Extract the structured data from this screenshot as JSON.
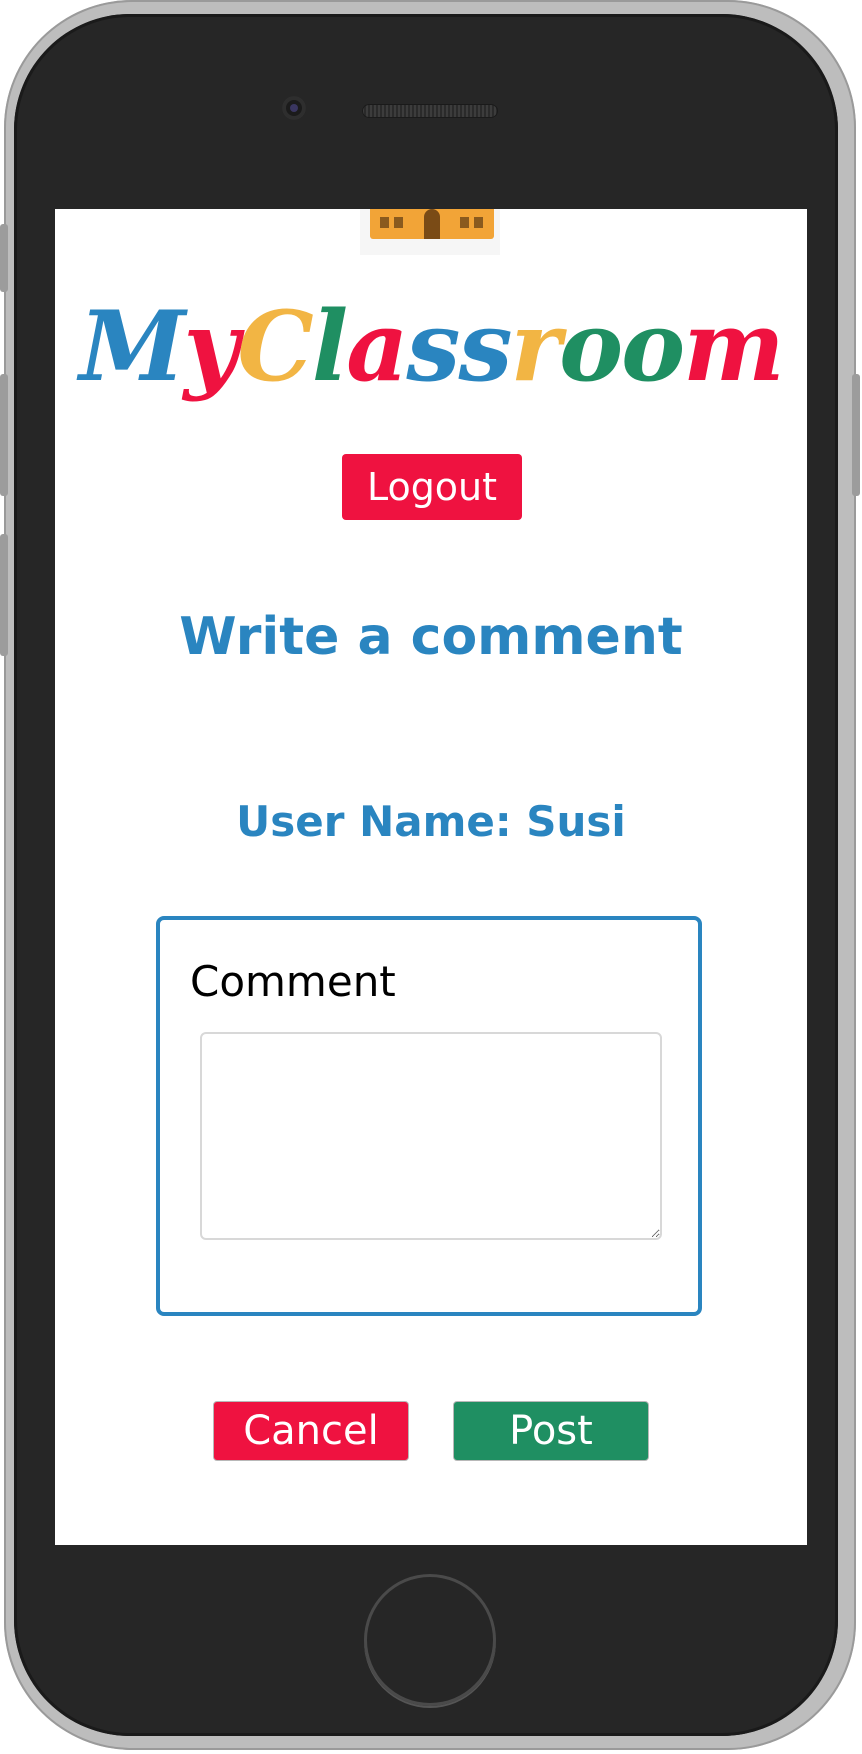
{
  "app": {
    "logo_letters": [
      {
        "char": "M",
        "color": "#2a85c0"
      },
      {
        "char": "y",
        "color": "#ef1240"
      },
      {
        "char": "C",
        "color": "#f2b544"
      },
      {
        "char": "l",
        "color": "#1f8f62"
      },
      {
        "char": "a",
        "color": "#ef1240"
      },
      {
        "char": "s",
        "color": "#2a85c0"
      },
      {
        "char": "s",
        "color": "#2a85c0"
      },
      {
        "char": "r",
        "color": "#f2b544"
      },
      {
        "char": "o",
        "color": "#1f8f62"
      },
      {
        "char": "o",
        "color": "#1f8f62"
      },
      {
        "char": "m",
        "color": "#ef1240"
      }
    ],
    "logo_icon": "school-icon"
  },
  "header": {
    "logout_label": "Logout"
  },
  "page": {
    "title": "Write a comment",
    "user_name_label": "User Name:",
    "user_name_value": "Susi"
  },
  "form": {
    "comment_label": "Comment",
    "comment_value": "",
    "cancel_label": "Cancel",
    "post_label": "Post"
  },
  "colors": {
    "primary_blue": "#2a85c0",
    "danger_red": "#ef1240",
    "success_green": "#1f8f62",
    "accent_yellow": "#f2b544"
  }
}
